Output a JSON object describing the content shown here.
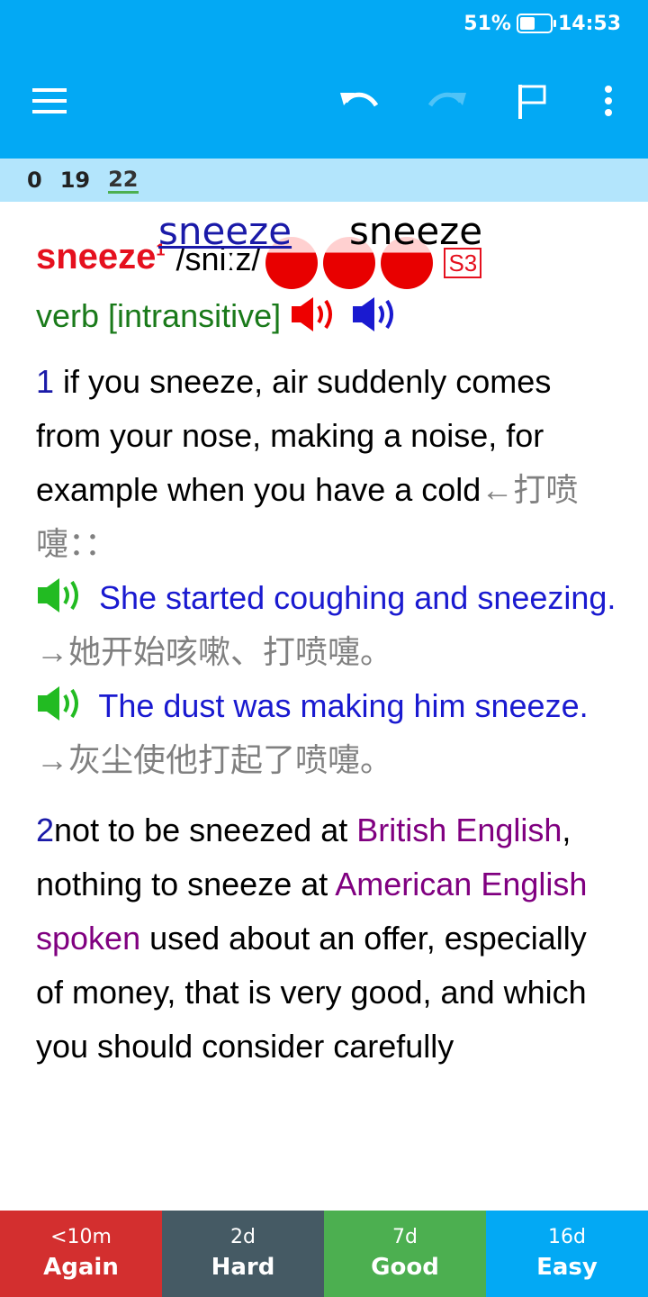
{
  "status_bar": {
    "battery_pct": "51%",
    "battery_level": 0.51,
    "time": "14:53"
  },
  "toolbar": {
    "menu_icon": "hamburger-menu-icon",
    "undo_icon": "undo-icon",
    "redo_icon": "redo-icon",
    "flag_icon": "flag-icon",
    "more_icon": "more-vert-icon",
    "background": "#03A9F4"
  },
  "counts": {
    "new": "0",
    "learning": "19",
    "review": "22"
  },
  "card": {
    "word_link": "sneeze ",
    "word_plain": "sneeze",
    "headword": "sneeze",
    "headword_sup": "1",
    "pronunciation": "/sniːz/",
    "frequency": "S3",
    "part_of_speech": "verb [intransitive]",
    "sense1": {
      "number": "1",
      "definition": " if you sneeze, air suddenly comes from your nose, making a noise, for example when you have a cold",
      "translation": "←打喷嚏：：",
      "examples": [
        {
          "en": " She started coughing and sneezing.",
          "zh": "→她开始咳嗽、打喷嚏。"
        },
        {
          "en": " The dust was making him sneeze.",
          "zh": "→灰尘使他打起了喷嚏。"
        }
      ]
    },
    "sense2": {
      "number": "2",
      "phrase1": "not to be sneezed at ",
      "region1": "British English",
      "phrase2": ", nothing to sneeze at ",
      "region2": "American English spoken",
      "definition": " used about an offer, especially of money, that is very good, and which you should consider carefully"
    }
  },
  "answer_buttons": [
    {
      "interval": "<10m",
      "label": "Again",
      "color": "#D32F2F"
    },
    {
      "interval": "2d",
      "label": "Hard",
      "color": "#455A64"
    },
    {
      "interval": "7d",
      "label": "Good",
      "color": "#4CAF50"
    },
    {
      "interval": "16d",
      "label": "Easy",
      "color": "#03A9F4"
    }
  ]
}
